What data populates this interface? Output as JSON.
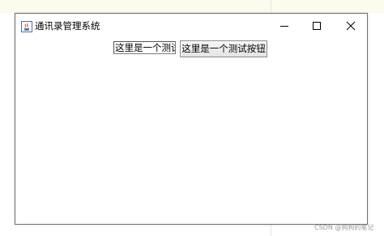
{
  "window": {
    "title": "通讯录管理系统",
    "controls": {
      "minimize_icon": "minimize-icon",
      "maximize_icon": "maximize-icon",
      "close_icon": "close-icon"
    }
  },
  "content": {
    "text_field_value": "这里是一个测试",
    "button_label": "这里是一个测试按钮"
  },
  "watermark": "CSDN @狗狗的笔记"
}
